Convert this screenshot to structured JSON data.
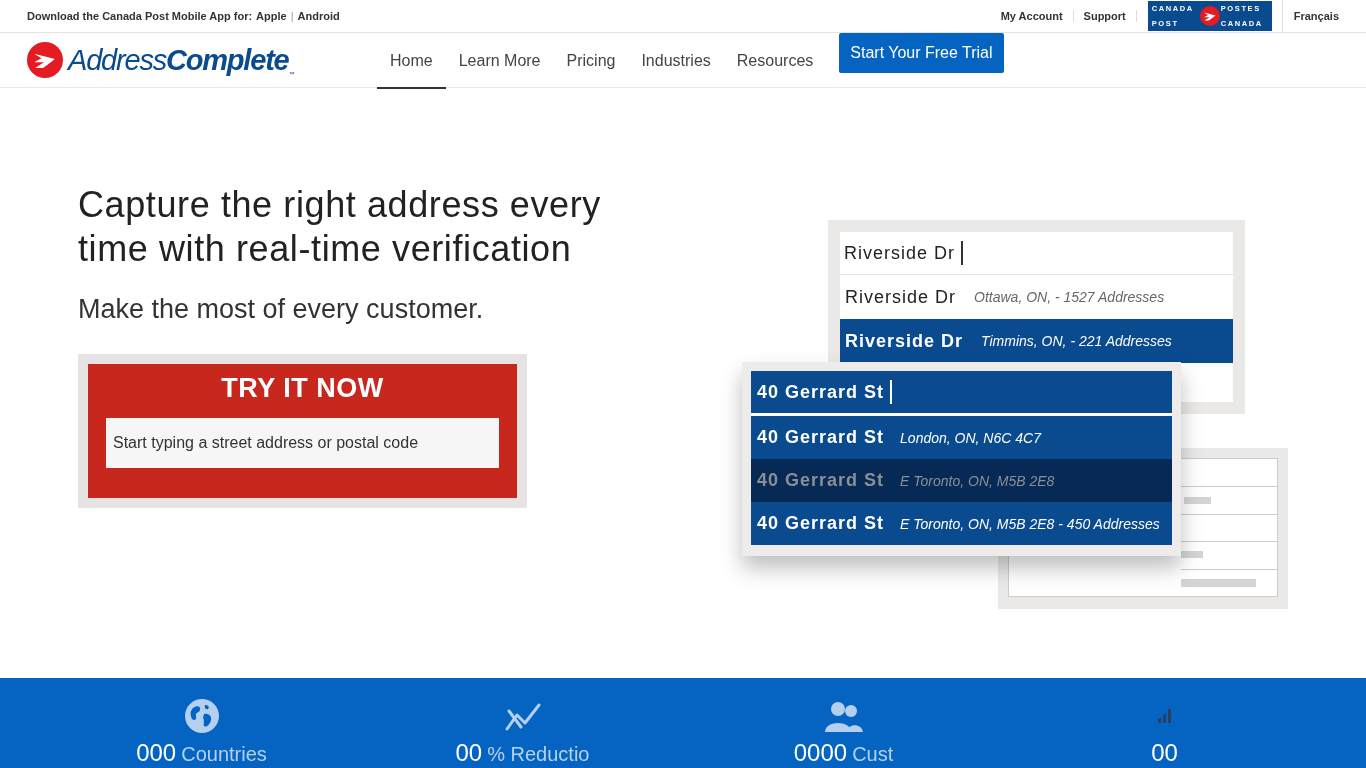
{
  "top_bar": {
    "promo": "Download the Canada Post Mobile App for:",
    "app_links": [
      "Apple",
      "Android"
    ],
    "app_link_separator": "|",
    "account_links": [
      "My Account",
      "Support"
    ],
    "brand_words": [
      "CANADA",
      "POSTES",
      "POST",
      "CANADA"
    ],
    "language": "Français"
  },
  "header": {
    "logo": {
      "light": "Address",
      "bold": "Complete",
      "mark": "™"
    },
    "nav": [
      {
        "label": "Home",
        "selected": true
      },
      {
        "label": "Learn More",
        "selected": false
      },
      {
        "label": "Pricing",
        "selected": false
      },
      {
        "label": "Industries",
        "selected": false
      },
      {
        "label": "Resources",
        "selected": false
      }
    ],
    "cta": "Start Your Free Trial"
  },
  "hero": {
    "headline": "Capture the right address every time with real-time verification",
    "subhead": "Make the most of every customer.",
    "try_panel": {
      "title": "TRY IT NOW",
      "placeholder": "Start typing a street address or postal code"
    }
  },
  "demo": {
    "back_card": {
      "query": "Riverside Dr",
      "suggestions": [
        {
          "street": "Riverside Dr",
          "detail": "Ottawa, ON, - 1527 Addresses",
          "selected": false
        },
        {
          "street": "Riverside Dr",
          "detail": "Timmins, ON, - 221 Addresses",
          "selected": true
        }
      ]
    },
    "front_card": {
      "query": "40 Gerrard St",
      "suggestions": [
        {
          "street": "40 Gerrard St",
          "detail": "London, ON, N6C 4C7",
          "disabled": false
        },
        {
          "street": "40 Gerrard St",
          "detail": "E Toronto, ON, M5B 2E8",
          "disabled": true
        },
        {
          "street": "40 Gerrard St",
          "detail": "E Toronto, ON, M5B 2E8 - 450 Addresses",
          "disabled": false
        }
      ]
    }
  },
  "stats": [
    {
      "kind": "globe",
      "number": "000",
      "label": "Countries"
    },
    {
      "kind": "trend",
      "number": "00",
      "label": "% Reductio"
    },
    {
      "kind": "people",
      "number": "0000",
      "label": "Cust"
    },
    {
      "kind": "bars",
      "number": "00"
    }
  ]
}
